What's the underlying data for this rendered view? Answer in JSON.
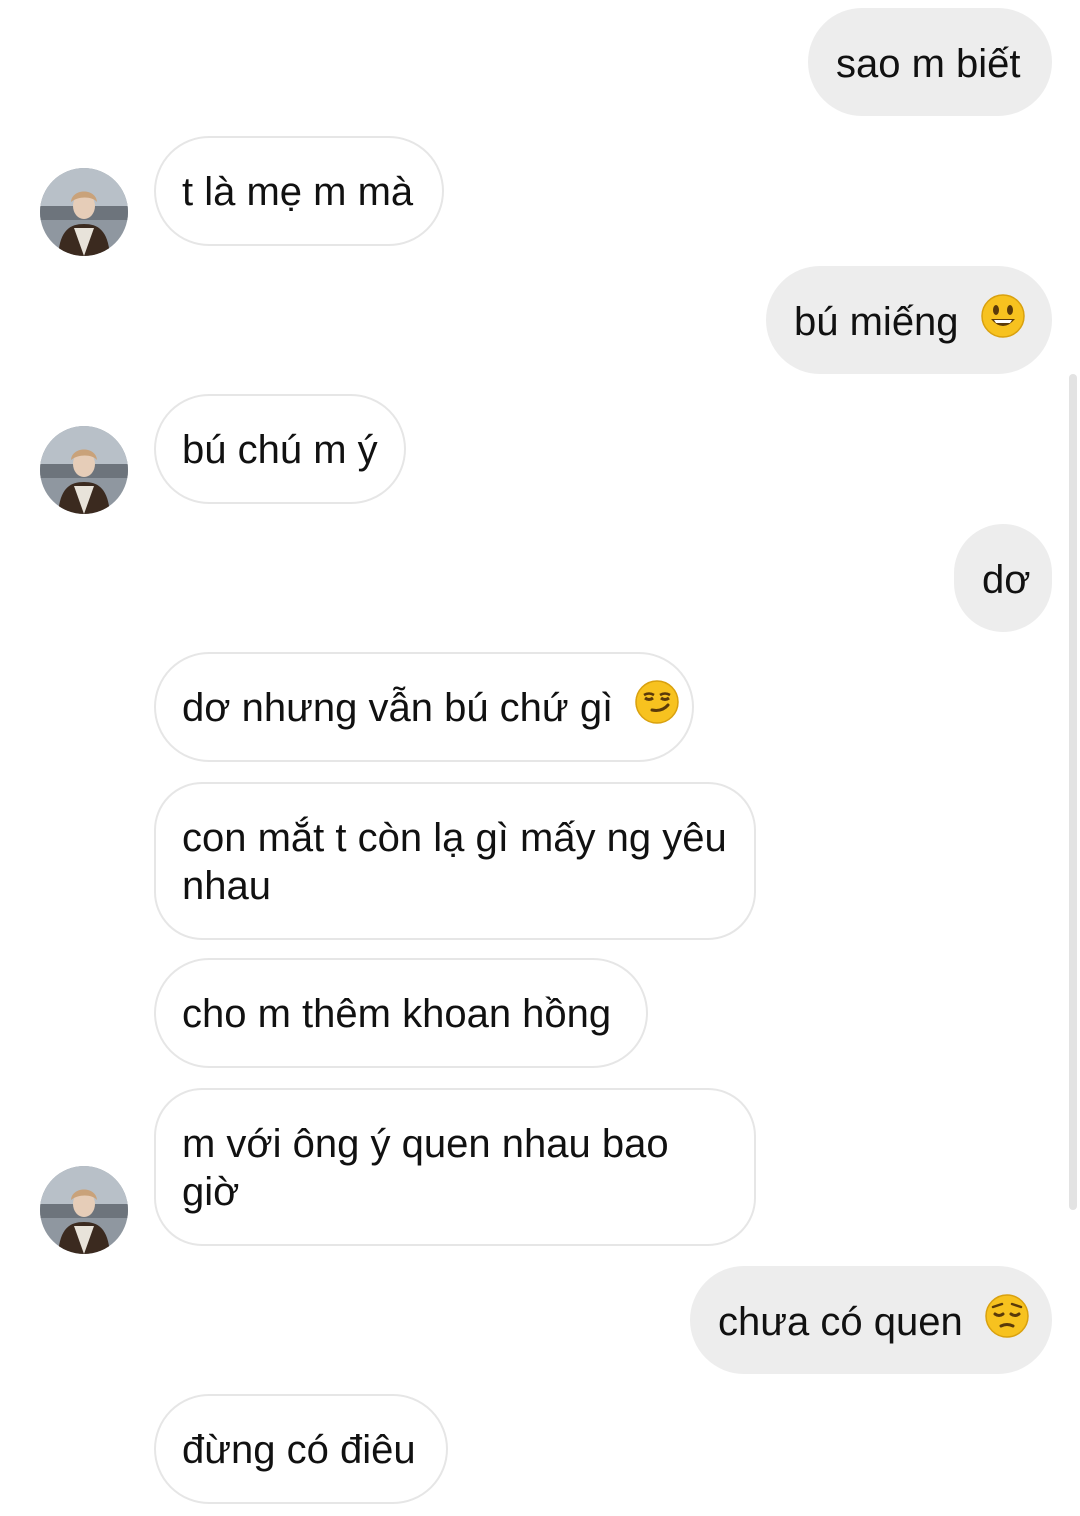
{
  "messages": [
    {
      "side": "out",
      "text": "sao m biết"
    },
    {
      "side": "in",
      "text": "t là mẹ m mà"
    },
    {
      "side": "out",
      "text": "bú miếng",
      "emoji": "grinning-face-emoji"
    },
    {
      "side": "in",
      "text": "bú chú m ý"
    },
    {
      "side": "out",
      "text": "dơ"
    },
    {
      "side": "in",
      "text": "dơ nhưng vẫn bú chứ gì",
      "emoji": "smirking-face-emoji"
    },
    {
      "side": "in",
      "text": "con mắt t còn lạ gì mấy ng yêu nhau"
    },
    {
      "side": "in",
      "text": "cho m thêm khoan hồng"
    },
    {
      "side": "in",
      "text": "m với ông ý quen nhau bao giờ"
    },
    {
      "side": "out",
      "text": "chưa có quen",
      "emoji": "pensive-face-emoji"
    },
    {
      "side": "in",
      "text": "đừng có điêu"
    }
  ],
  "colors": {
    "outgoing_bubble": "#ededed",
    "incoming_border": "#e6e6e6",
    "emoji_yellow": "#f7c21f",
    "text": "#111111"
  }
}
